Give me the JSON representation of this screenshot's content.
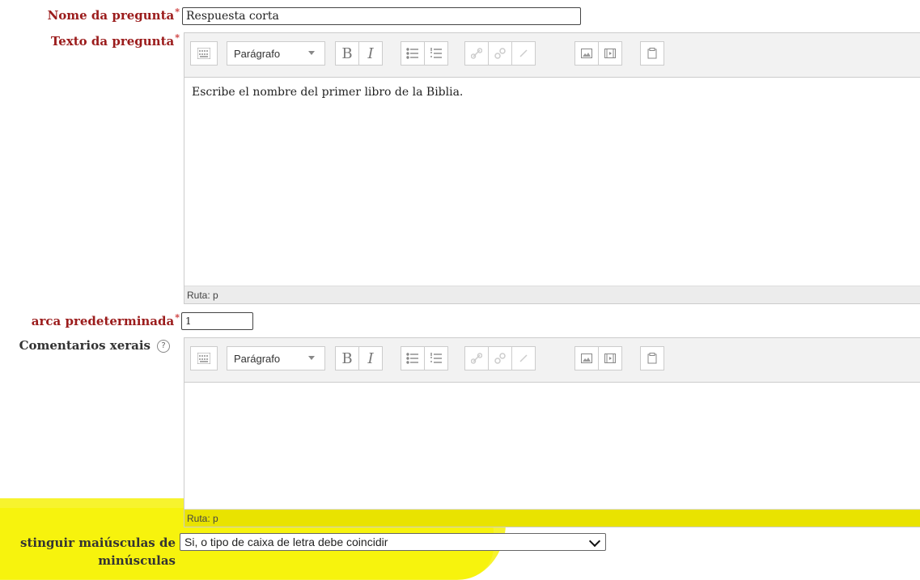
{
  "fields": {
    "nome": {
      "label": "Nome da pregunta",
      "required_mark": "*",
      "value": "Respuesta corta"
    },
    "texto": {
      "label": "Texto da pregunta",
      "required_mark": "*",
      "content": "Escribe el nombre del primer libro de la Biblia.",
      "path": "Ruta: p"
    },
    "marca": {
      "label": "arca predeterminada",
      "required_mark": "*",
      "value": "1"
    },
    "comentarios": {
      "label": "Comentarios xerais",
      "help_icon": "question-circle-icon",
      "path": "Ruta: p"
    },
    "distinguir": {
      "label_line1": "stinguir maiúsculas de",
      "label_line2": "minúsculas",
      "selected": "Si, o tipo de caixa de letra debe coincidir"
    }
  },
  "toolbar": {
    "paragraph_label": "Parágrafo",
    "bold": "B",
    "italic": "I",
    "icons": [
      "toolbar-toggle-icon",
      "paragraph-dropdown",
      "bold-icon",
      "italic-icon",
      "unordered-list-icon",
      "ordered-list-icon",
      "link-icon",
      "unlink-icon",
      "anchor-icon",
      "image-icon",
      "media-icon",
      "manage-files-icon"
    ]
  },
  "colors": {
    "label_red": "#9b1c1c",
    "required_red": "#cc3333",
    "highlight_yellow": "#f5f000"
  }
}
